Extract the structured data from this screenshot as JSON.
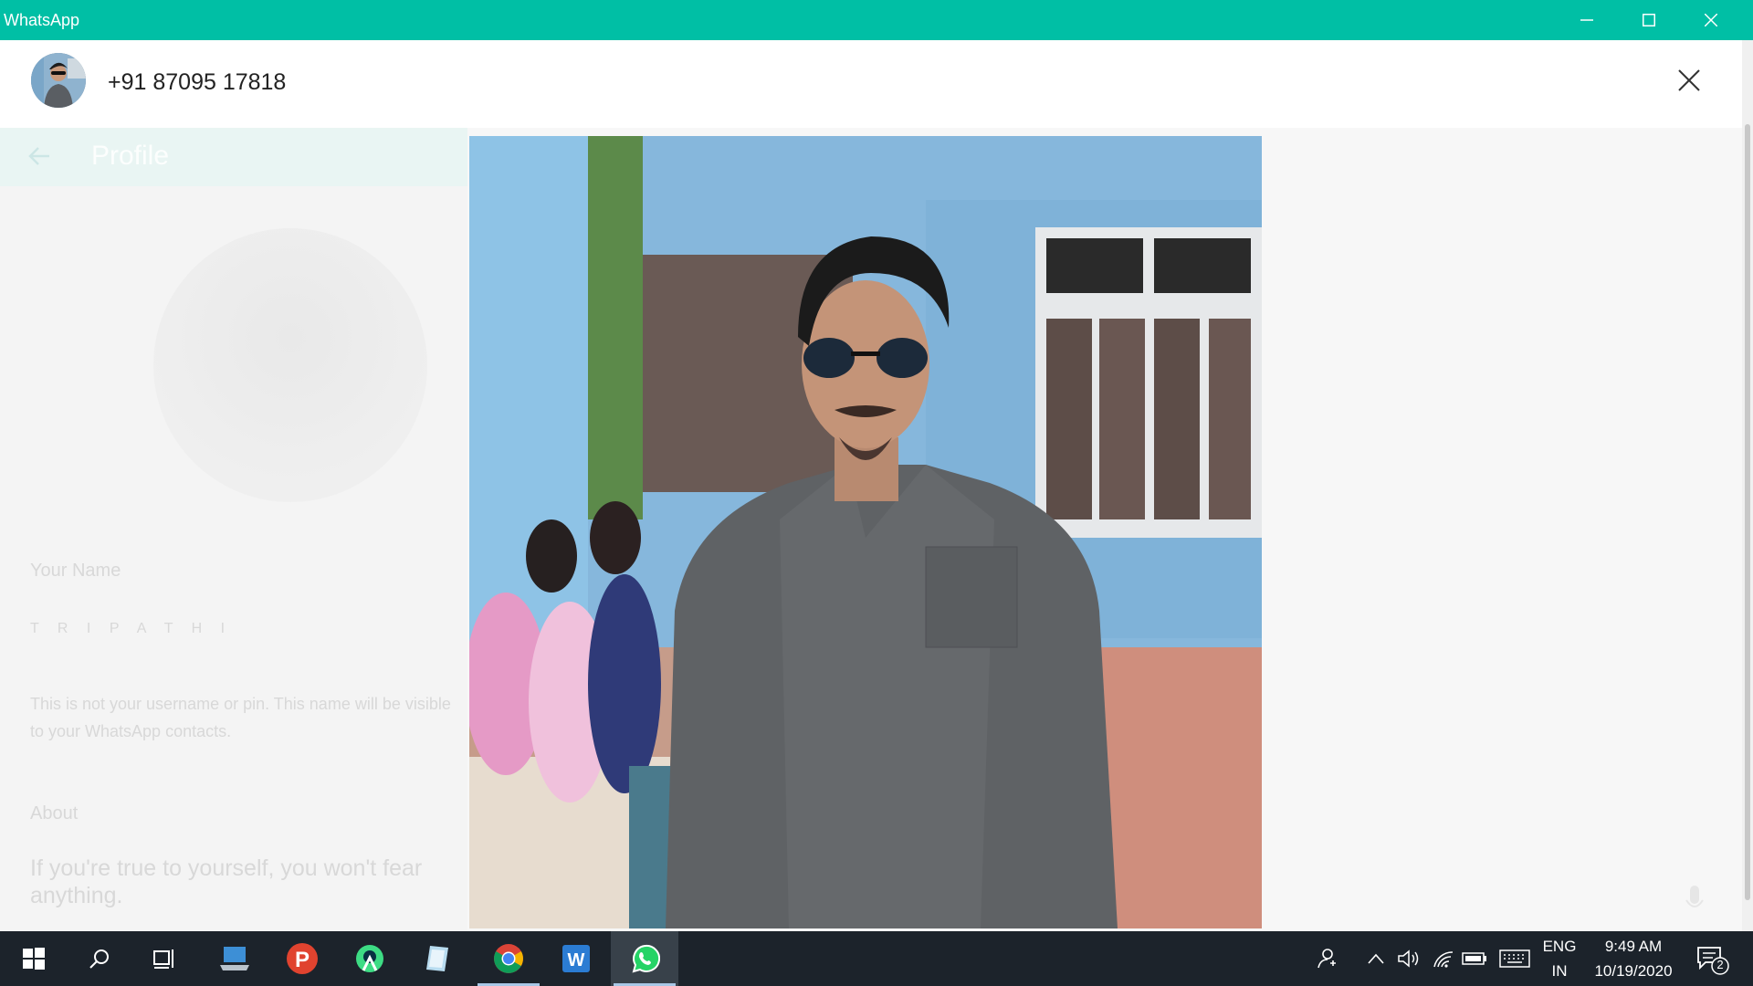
{
  "window": {
    "title": "WhatsApp",
    "minimize_icon": "minimize-icon",
    "maximize_icon": "maximize-icon",
    "close_icon": "close-icon",
    "accent_color": "#00bfa5"
  },
  "profile_panel": {
    "title": "Profile",
    "name_label": "Your Name",
    "name_value": "T R I P A T H I",
    "name_note": "This is not your username or pin. This name will be visible to your WhatsApp contacts.",
    "about_label": "About",
    "about_value": "If you're true to yourself, you won't fear anything."
  },
  "viewer": {
    "contact_number": "+91 87095 17818",
    "close_icon": "close-icon"
  },
  "taskbar": {
    "apps": [
      {
        "name": "start-button",
        "icon": "windows-logo-icon"
      },
      {
        "name": "search-button",
        "icon": "search-icon"
      },
      {
        "name": "task-view-button",
        "icon": "task-view-icon"
      },
      {
        "name": "laptop-app",
        "icon": "laptop-icon"
      },
      {
        "name": "psiphon-app",
        "icon": "p-logo-icon"
      },
      {
        "name": "android-studio-app",
        "icon": "android-studio-icon"
      },
      {
        "name": "notes-app",
        "icon": "notes-icon"
      },
      {
        "name": "chrome-app",
        "icon": "chrome-icon"
      },
      {
        "name": "word-app",
        "icon": "word-icon"
      },
      {
        "name": "whatsapp-app",
        "icon": "whatsapp-icon",
        "active": true
      }
    ],
    "tray": {
      "language_line1": "ENG",
      "language_line2": "IN",
      "time": "9:49 AM",
      "date": "10/19/2020",
      "notification_count": "2"
    }
  }
}
